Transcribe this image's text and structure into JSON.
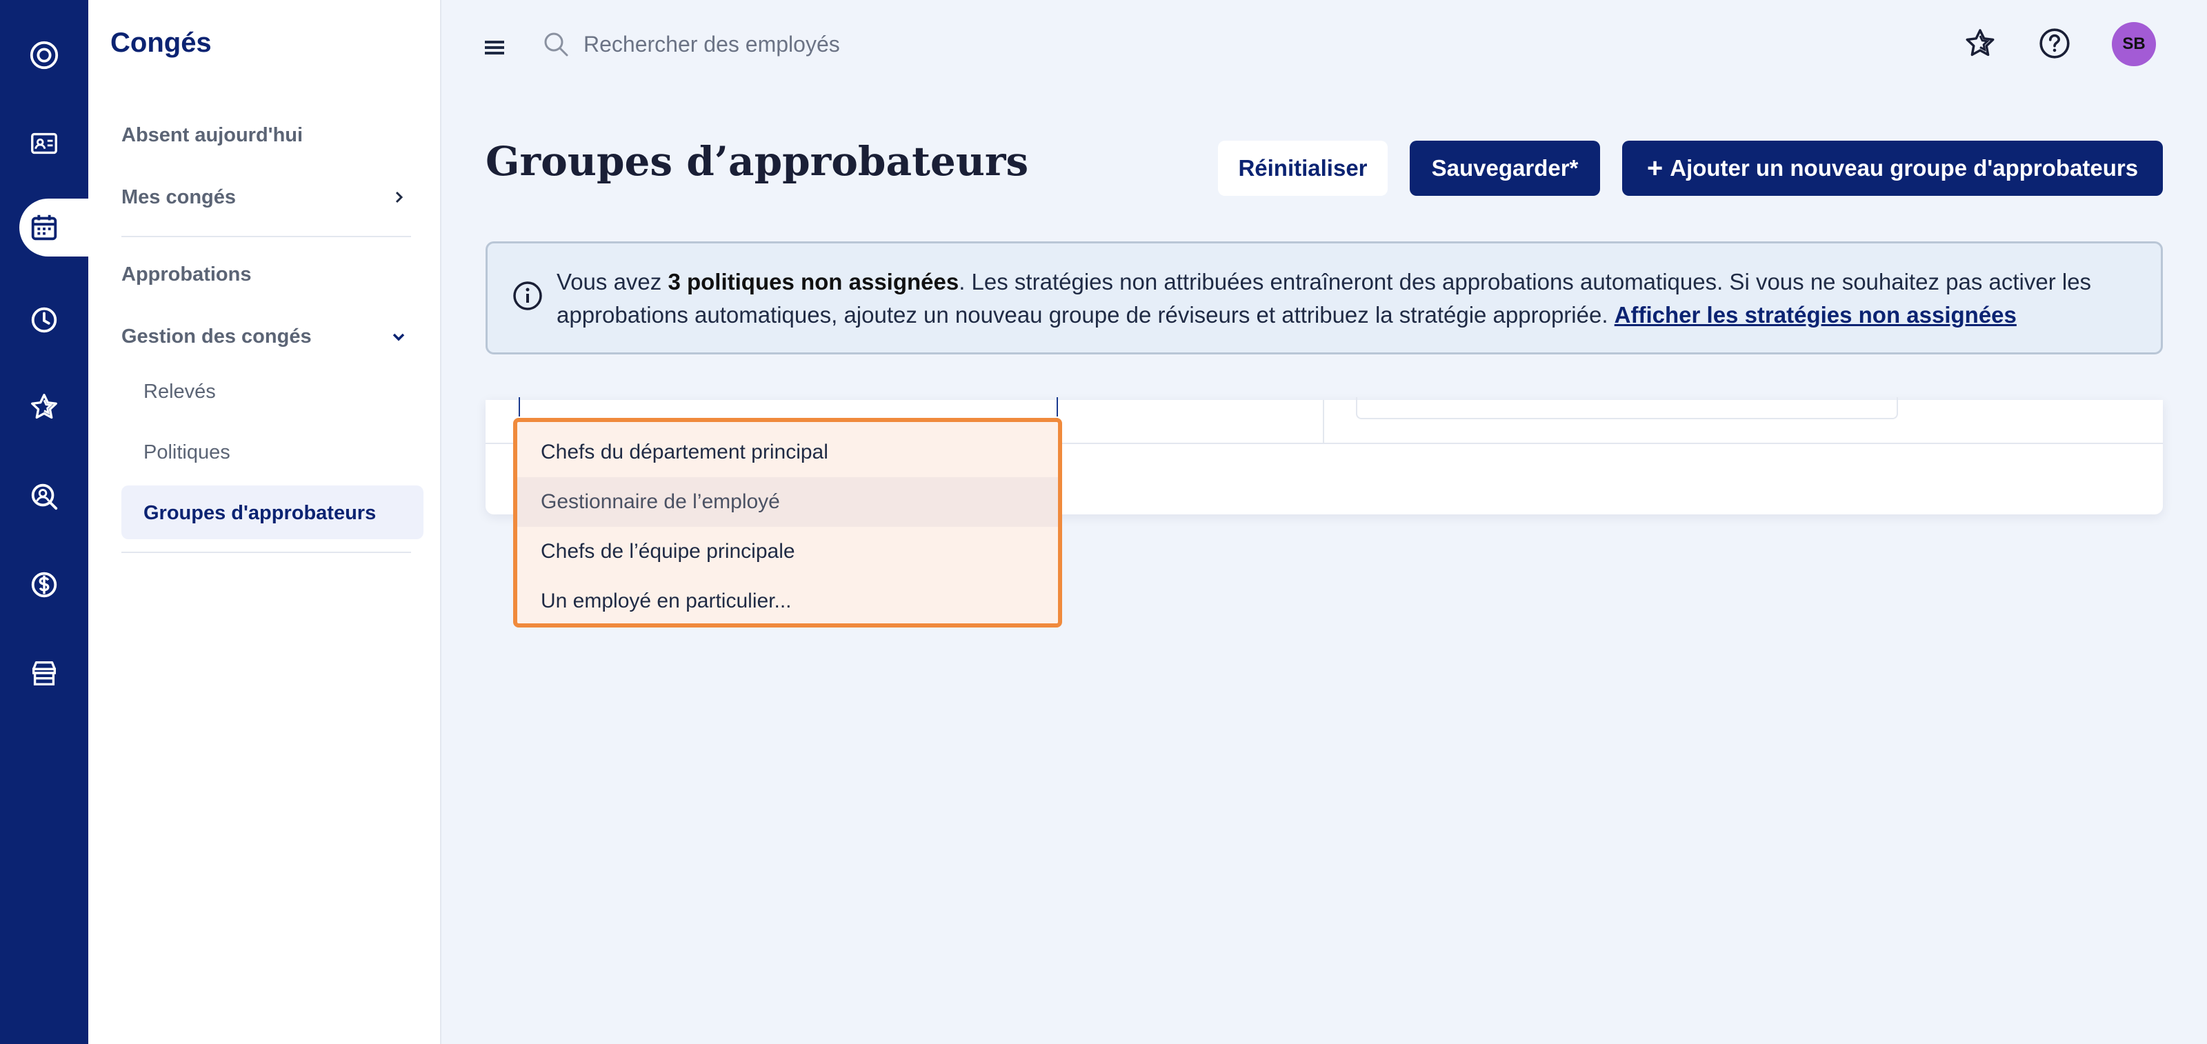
{
  "sidebar": {
    "title": "Congés",
    "items": {
      "absent_today": "Absent aujourd'hui",
      "my_leave": "Mes congés",
      "approvals": "Approbations",
      "leave_management": "Gestion des congés",
      "statements": "Relevés",
      "policies": "Politiques",
      "approver_groups": "Groupes d'approbateurs"
    }
  },
  "topbar": {
    "search_placeholder": "Rechercher des employés",
    "avatar_initials": "SB"
  },
  "page": {
    "title": "Groupes d’approbateurs",
    "reset_label": "Réinitialiser",
    "save_label": "Sauvegarder*",
    "add_label": "Ajouter un nouveau groupe d'approbateurs"
  },
  "banner": {
    "prefix": "Vous avez ",
    "bold": "3 politiques non assignées",
    "body": ". Les stratégies non attribuées entraîneront des approbations automatiques. Si vous ne souhaitez pas activer les approbations automatiques, ajoutez un nouveau groupe de réviseurs et attribuez la stratégie appropriée. ",
    "link": "Afficher les stratégies non assignées"
  },
  "dropdown": {
    "options": [
      "Chefs du département principal",
      "Gestionnaire de l’employé",
      "Chefs de l’équipe principale",
      "Un employé en particulier..."
    ]
  },
  "colors": {
    "rail": "#0b2372",
    "primary": "#0b2372",
    "dropdown_border": "#f08a3c",
    "avatar": "#a35bd5"
  }
}
